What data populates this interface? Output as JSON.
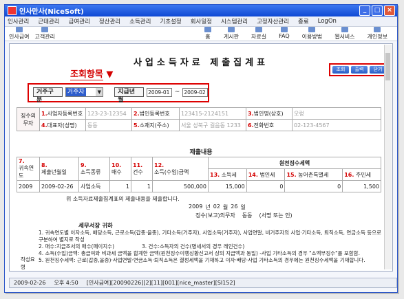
{
  "window": {
    "title": "인사만사(NiceSoft)"
  },
  "menu": [
    "인사관리",
    "근태관리",
    "급여관리",
    "정산관리",
    "소득관리",
    "기초설정",
    "회사일정",
    "시스템관리",
    "고정자산관리",
    "종료",
    "LogOn"
  ],
  "toolbar": {
    "left": [
      "인사급여",
      "고객관리"
    ],
    "right": [
      "홈",
      "게시판",
      "자료실",
      "FAQ",
      "이용방법",
      "웹서비스",
      "개인정보"
    ]
  },
  "page": {
    "title": "사업소득자료 제출집계표",
    "annotation": "조회항목",
    "buttons": {
      "search": "조회",
      "print": "출력",
      "close": "닫기"
    },
    "filter": {
      "type_label": "거주구분",
      "type_value": "거주자",
      "date_label": "지급년월",
      "date_from": "2009-01",
      "date_to": "2009-02",
      "tilde": "~"
    }
  },
  "payer": {
    "section": "징수의무자",
    "f1": {
      "no": "1.",
      "label": "사업자등록번호",
      "value": "123-23-12354"
    },
    "f2": {
      "no": "2.",
      "label": "법인등록번호",
      "value": "123415-2124151"
    },
    "f3": {
      "no": "3.",
      "label": "법인명(상호)",
      "value": "오렁"
    },
    "f4": {
      "no": "4.",
      "label": "대표자(성명)",
      "value": "동동"
    },
    "f5": {
      "no": "5.",
      "label": "소재지(주소)",
      "value": "서울 성북구 길음동 1233"
    },
    "f6": {
      "no": "6.",
      "label": "전화번호",
      "value": "02-123-4567"
    }
  },
  "submission": {
    "section": "제출내용",
    "headers": {
      "h7": "7.",
      "h7b": "귀속연도",
      "h8": "8.",
      "h8b": "제출년월일",
      "h9": "9.",
      "h9b": "소득종류",
      "h10": "10.",
      "h10b": "매수",
      "h11": "11.",
      "h11b": "건수",
      "h12": "12.",
      "h12b": "소득(수입)금액",
      "wh": "원천징수세액",
      "h13": "13.",
      "h13b": "소득세",
      "h14": "14.",
      "h14b": "법인세",
      "h15": "15.",
      "h15b": "농어촌특별세",
      "h16": "16.",
      "h16b": "주민세"
    },
    "row": {
      "year": "2009",
      "date": "2009-02-26",
      "kind": "사업소득",
      "sheets": "1",
      "count": "1",
      "amount": "500,000",
      "income_tax": "15,000",
      "corp_tax": "0",
      "rural_tax": "0",
      "resident_tax": "1,500"
    }
  },
  "statement": {
    "text": "위 소득자료제출집계표의 제출내용을 제출합니다.",
    "year": "2009",
    "y": "년",
    "month": "02",
    "m": "월",
    "day": "26",
    "d": "일",
    "payer_label": "징수(보고)의무자",
    "payer_name": "동동",
    "sign": "(서명 또는 인)",
    "to": "세무서장 귀하"
  },
  "notes": {
    "label": "작성요령",
    "n1": "1. 귀속연도별 이자소득, 배당소득, 근로소득(갑종·을종), 기타소득(거주자), 사업소득(거주자), 사업연말, 비거주자의 사업·기타소득, 퇴직소득, 연금소득 등으로 구분하여 별지로 작성",
    "n2": "2. 매수:지급조서의 매수(페이지수)",
    "n3": "3. 건수:소득자의 건수(명세서의 경우 레인건수)",
    "n4": "4. 소득(수입)금액: 총급여와 비과세 금액을 합계한 금액(원천징수이행상황신고서 상의 지급액과 동일) -사업 기타소득의 경우 \"소액부징수\"를 포함함.",
    "n5": "5. 원천징수세액: 근로(갑종,을종)·사업연말·연금소득·퇴직소득은 결정세액을 기재하고 이자·배당·사업 기타소득의 경우에는 원천징수세액을 기재합니다."
  },
  "status": {
    "date": "2009-02-26",
    "time": "오후 4:50",
    "info": "[인사급여][20090226][2][11][001][nice_master][SI152]"
  }
}
